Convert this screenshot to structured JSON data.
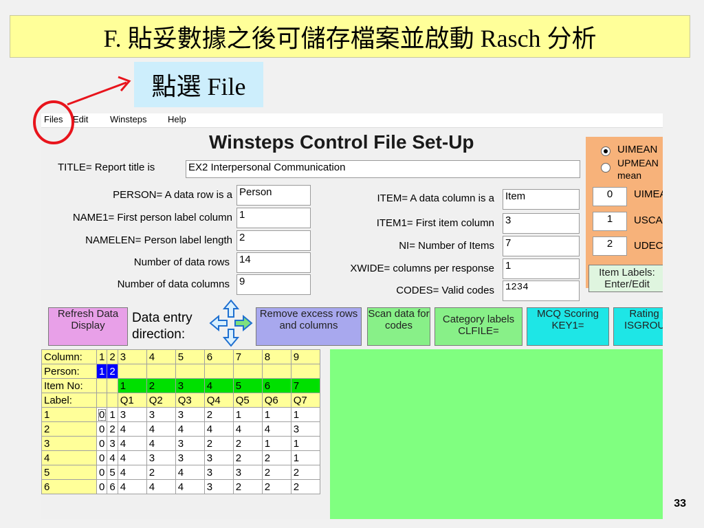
{
  "slide": {
    "title": "F. 貼妥數據之後可儲存檔案並啟動 Rasch 分析",
    "callout": "點選 File",
    "page_number": "33"
  },
  "menu": [
    "Files",
    "Edit",
    "Winsteps",
    "Help"
  ],
  "app_title": "Winsteps Control File Set-Up",
  "form": {
    "title_label": "TITLE= Report title is",
    "title_value": "EX2 Interpersonal Communication",
    "person_label": "PERSON= A data row is a",
    "person_value": "Person",
    "name1_label": "NAME1= First person label column",
    "name1_value": "1",
    "namelen_label": "NAMELEN= Person label length",
    "namelen_value": "2",
    "rows_label": "Number of data rows",
    "rows_value": "14",
    "cols_label": "Number of data columns",
    "cols_value": "9",
    "item_label": "ITEM= A data column is a",
    "item_value": "Item",
    "item1_label": "ITEM1= First item column",
    "item1_value": "3",
    "ni_label": "NI= Number of Items",
    "ni_value": "7",
    "xwide_label": "XWIDE= columns per response",
    "xwide_value": "1",
    "codes_label": "CODES= Valid codes",
    "codes_value": "1234"
  },
  "side_panel": {
    "radio1": "UIMEAN",
    "radio2": "UPMEAN",
    "radio2_sub": "mean",
    "fields": [
      {
        "value": "0",
        "label": "UIMEAN"
      },
      {
        "value": "1",
        "label": "USCALE"
      },
      {
        "value": "2",
        "label": "UDECIMALS"
      }
    ],
    "item_labels_button": "Item Labels: Enter/Edit"
  },
  "buttons": {
    "refresh": "Refresh Data Display",
    "direction": "Data entry direction:",
    "remove": "Remove excess rows and columns",
    "scan": "Scan data for codes",
    "category": "Category labels CLFILE=",
    "mcq": "MCQ Scoring KEY1=",
    "rating": "Rating part ISGROUPS="
  },
  "grid": {
    "row_headers": [
      "Column:",
      "Person:",
      "Item No:",
      "Label:"
    ],
    "columns": [
      "1",
      "2",
      "3",
      "4",
      "5",
      "6",
      "7",
      "8",
      "9"
    ],
    "person": [
      "1",
      "2",
      "",
      "",
      "",
      "",
      "",
      "",
      ""
    ],
    "item_no": [
      "",
      "",
      "1",
      "2",
      "3",
      "4",
      "5",
      "6",
      "7"
    ],
    "labels": [
      "",
      "",
      "Q1",
      "Q2",
      "Q3",
      "Q4",
      "Q5",
      "Q6",
      "Q7"
    ],
    "rows": [
      {
        "id": "1",
        "cells": [
          "0",
          "1",
          "3",
          "3",
          "3",
          "2",
          "1",
          "1",
          "1"
        ]
      },
      {
        "id": "2",
        "cells": [
          "0",
          "2",
          "4",
          "4",
          "4",
          "4",
          "4",
          "4",
          "3"
        ]
      },
      {
        "id": "3",
        "cells": [
          "0",
          "3",
          "4",
          "4",
          "3",
          "2",
          "2",
          "1",
          "1"
        ]
      },
      {
        "id": "4",
        "cells": [
          "0",
          "4",
          "4",
          "3",
          "3",
          "3",
          "2",
          "2",
          "1"
        ]
      },
      {
        "id": "5",
        "cells": [
          "0",
          "5",
          "4",
          "2",
          "4",
          "3",
          "3",
          "2",
          "2"
        ]
      },
      {
        "id": "6",
        "cells": [
          "0",
          "6",
          "4",
          "4",
          "4",
          "3",
          "2",
          "2",
          "2"
        ]
      }
    ]
  },
  "colors": {
    "title_bg": "#ffff99",
    "callout_bg": "#cdeefc",
    "annotation": "#e8141c",
    "grid_yellow": "#ffff99",
    "grid_green": "#00e000",
    "data_area": "#80ff80",
    "panel_orange": "#f7b27a"
  }
}
